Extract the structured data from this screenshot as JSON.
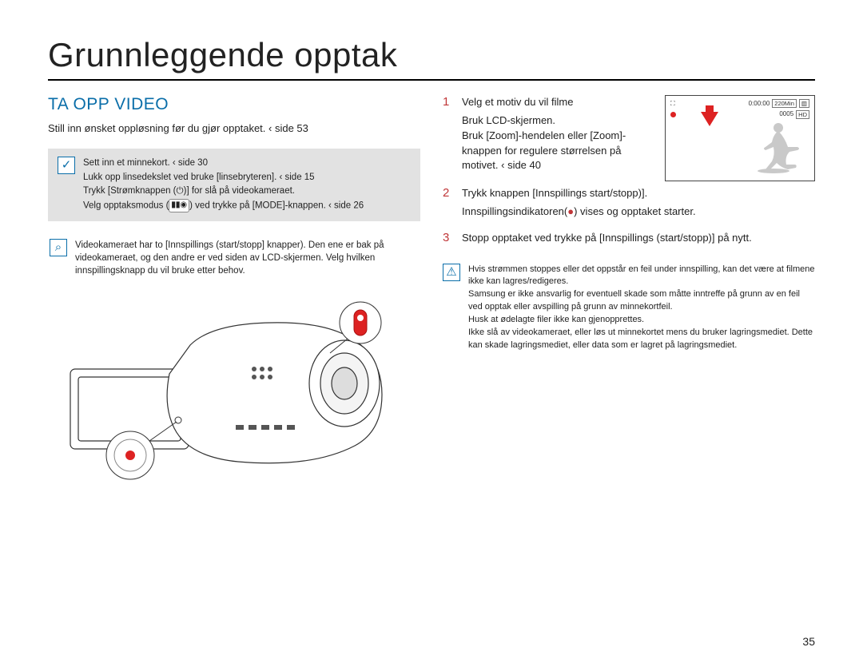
{
  "page_number": "35",
  "main_title": "Grunnleggende opptak",
  "section_title": "TA OPP VIDEO",
  "intro": "Still inn ønsket oppløsning før du gjør opptaket.   ‹ side 53",
  "note": {
    "l1": "Sett inn et minnekort. ‹ side 30",
    "l2": "Lukk opp linsedekslet ved  bruke [linsebryteren].   ‹ side 15",
    "l3_a": "Trykk [Strømknappen (",
    "l3_b": ")] for  slå på videokameraet.",
    "l4_a": "Velg opptaksmodus (",
    "l4_b": ") ved  trykke på [MODE]-knappen.  ‹ side 26",
    "mode_vid": "▮▮",
    "mode_pic": "◉"
  },
  "tip": "Videokameraet har to [Innspillings (start/stopp] knapper). Den ene er bak på videokameraet, og den andre er ved siden av LCD-skjermen. Velg hvilken innspillingsknapp du vil bruke etter behov.",
  "lcd": {
    "stby": "⛶",
    "time": "0:00:00",
    "remaining": "220Min",
    "batt": "▥",
    "count": "0005",
    "hd": "HD"
  },
  "steps": {
    "s1": {
      "num": "1",
      "head": "Velg et motiv du vil filme",
      "b1": "Bruk LCD-skjermen.",
      "b2": "Bruk [Zoom]-hendelen eller [Zoom]-knappen for  regulere størrelsen på motivet.   ‹ side 40"
    },
    "s2": {
      "num": "2",
      "head": "Trykk knappen [Innspillings start/stopp)].",
      "b1_a": "Innspillingsindikatoren(",
      "b1_b": ") vises og opptaket starter."
    },
    "s3": {
      "num": "3",
      "head": "Stopp opptaket ved  trykke på [Innspillings (start/stopp)] på nytt."
    }
  },
  "warn": {
    "p1": "Hvis strømmen stoppes eller det oppstår en feil under innspilling, kan det være at filmene ikke kan lagres/redigeres.",
    "p2": "Samsung er ikke ansvarlig for eventuell skade som måtte inntreffe på grunn av en feil ved opptak eller avspilling på grunn av minnekortfeil.",
    "p3": "Husk at ødelagte filer ikke kan gjenopprettes.",
    "p4": "Ikke slå av videokameraet, eller løs ut minnekortet mens du bruker lagringsmediet. Dette kan skade lagringsmediet, eller data som er lagret på lagringsmediet."
  },
  "icons": {
    "check": "✓",
    "magnify": "⌕",
    "warn": "⚠",
    "power": "⏻",
    "rec": "●"
  }
}
